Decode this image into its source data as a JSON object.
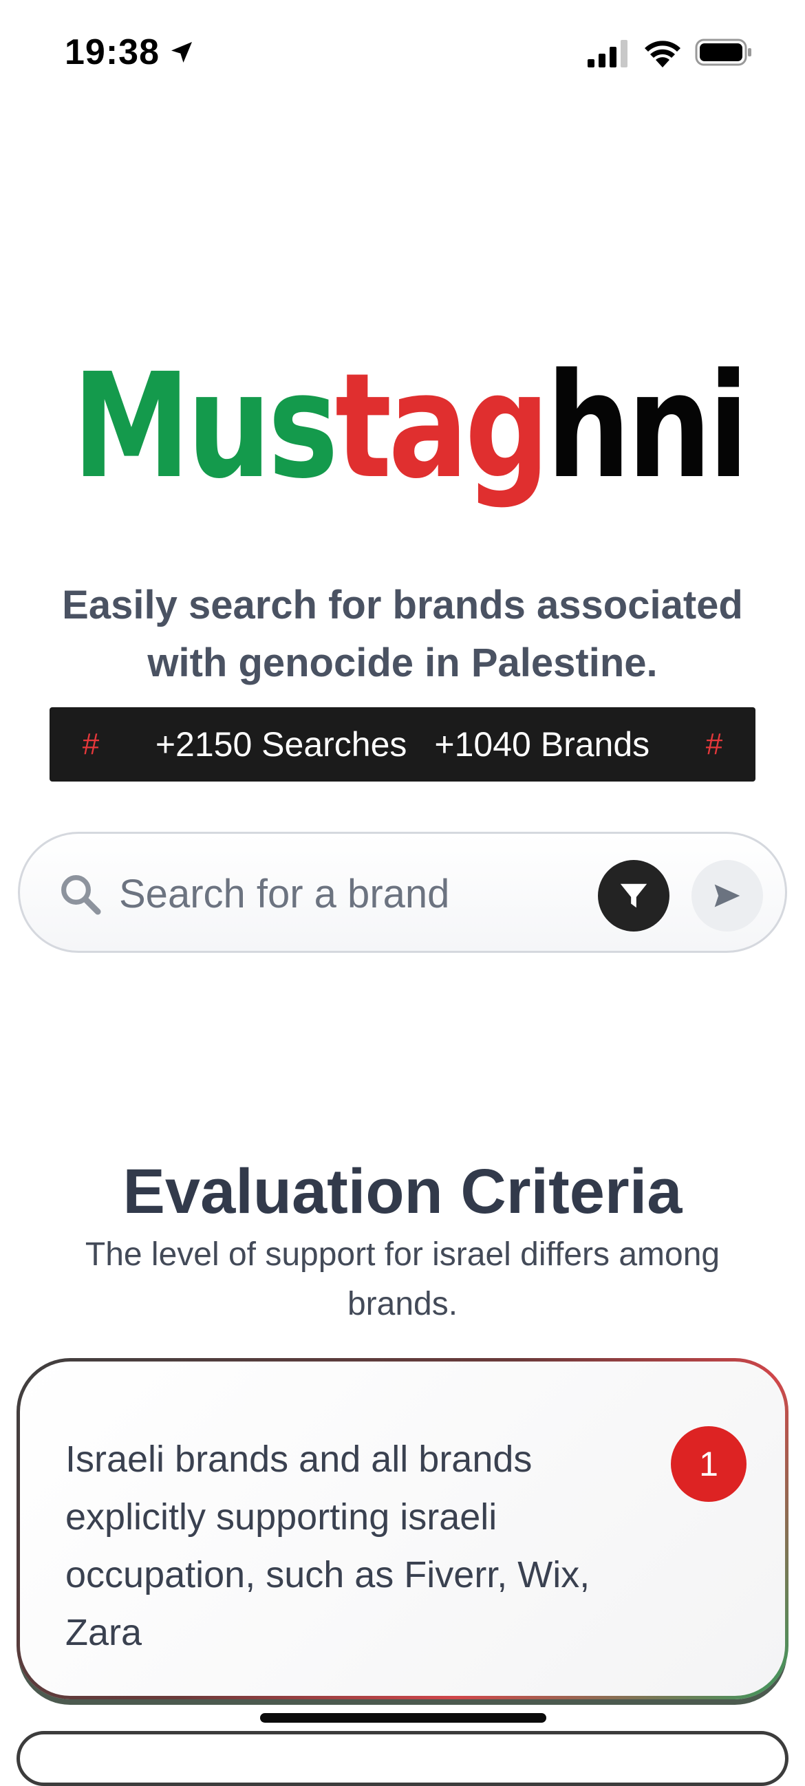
{
  "status_bar": {
    "time": "19:38"
  },
  "logo": {
    "part1": "Mus",
    "part2": "tag",
    "part3": "hni"
  },
  "tagline": "Easily search for brands associated with genocide in Palestine.",
  "stats": {
    "hash_left": "#",
    "searches": "+2150 Searches",
    "brands": "+1040 Brands",
    "hash_right": "#"
  },
  "search": {
    "placeholder": "Search for a brand"
  },
  "criteria": {
    "title": "Evaluation Criteria",
    "subtitle": "The level of support for israel differs among brands.",
    "cards": [
      {
        "badge": "1",
        "text": "Israeli brands and all brands explicitly supporting israeli occupation, such as Fiverr, Wix, Zara"
      }
    ]
  },
  "colors": {
    "green": "#149a4c",
    "red": "#e02f2f",
    "black": "#050505"
  }
}
